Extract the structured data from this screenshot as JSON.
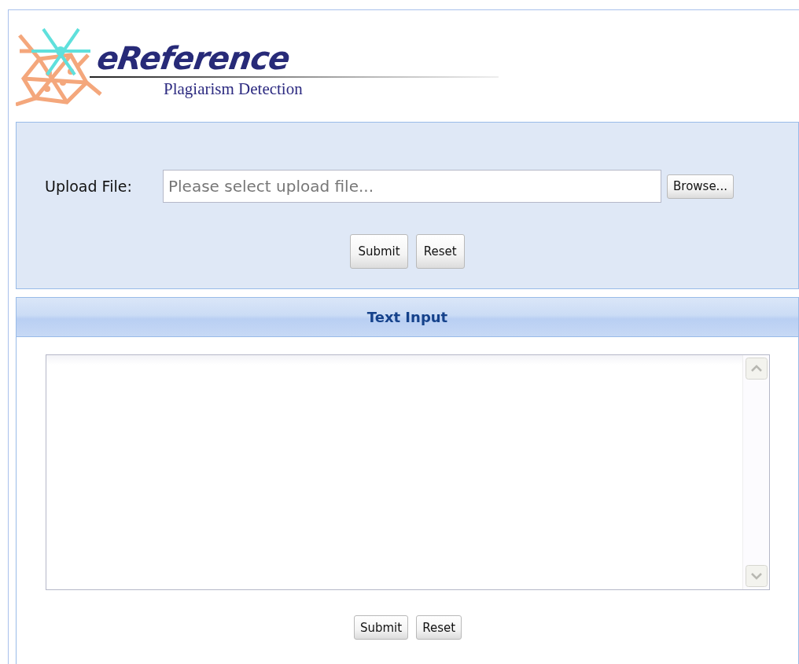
{
  "header": {
    "logo_title": "eReference",
    "logo_subtitle": "Plagiarism Detection"
  },
  "upload_panel": {
    "label": "Upload File:",
    "placeholder": "Please select upload file...",
    "browse_button": "Browse...",
    "buttons": [
      "Submit",
      "Reset"
    ]
  },
  "text_panel": {
    "title": "Text Input",
    "buttons": [
      "Submit",
      "Reset"
    ]
  }
}
